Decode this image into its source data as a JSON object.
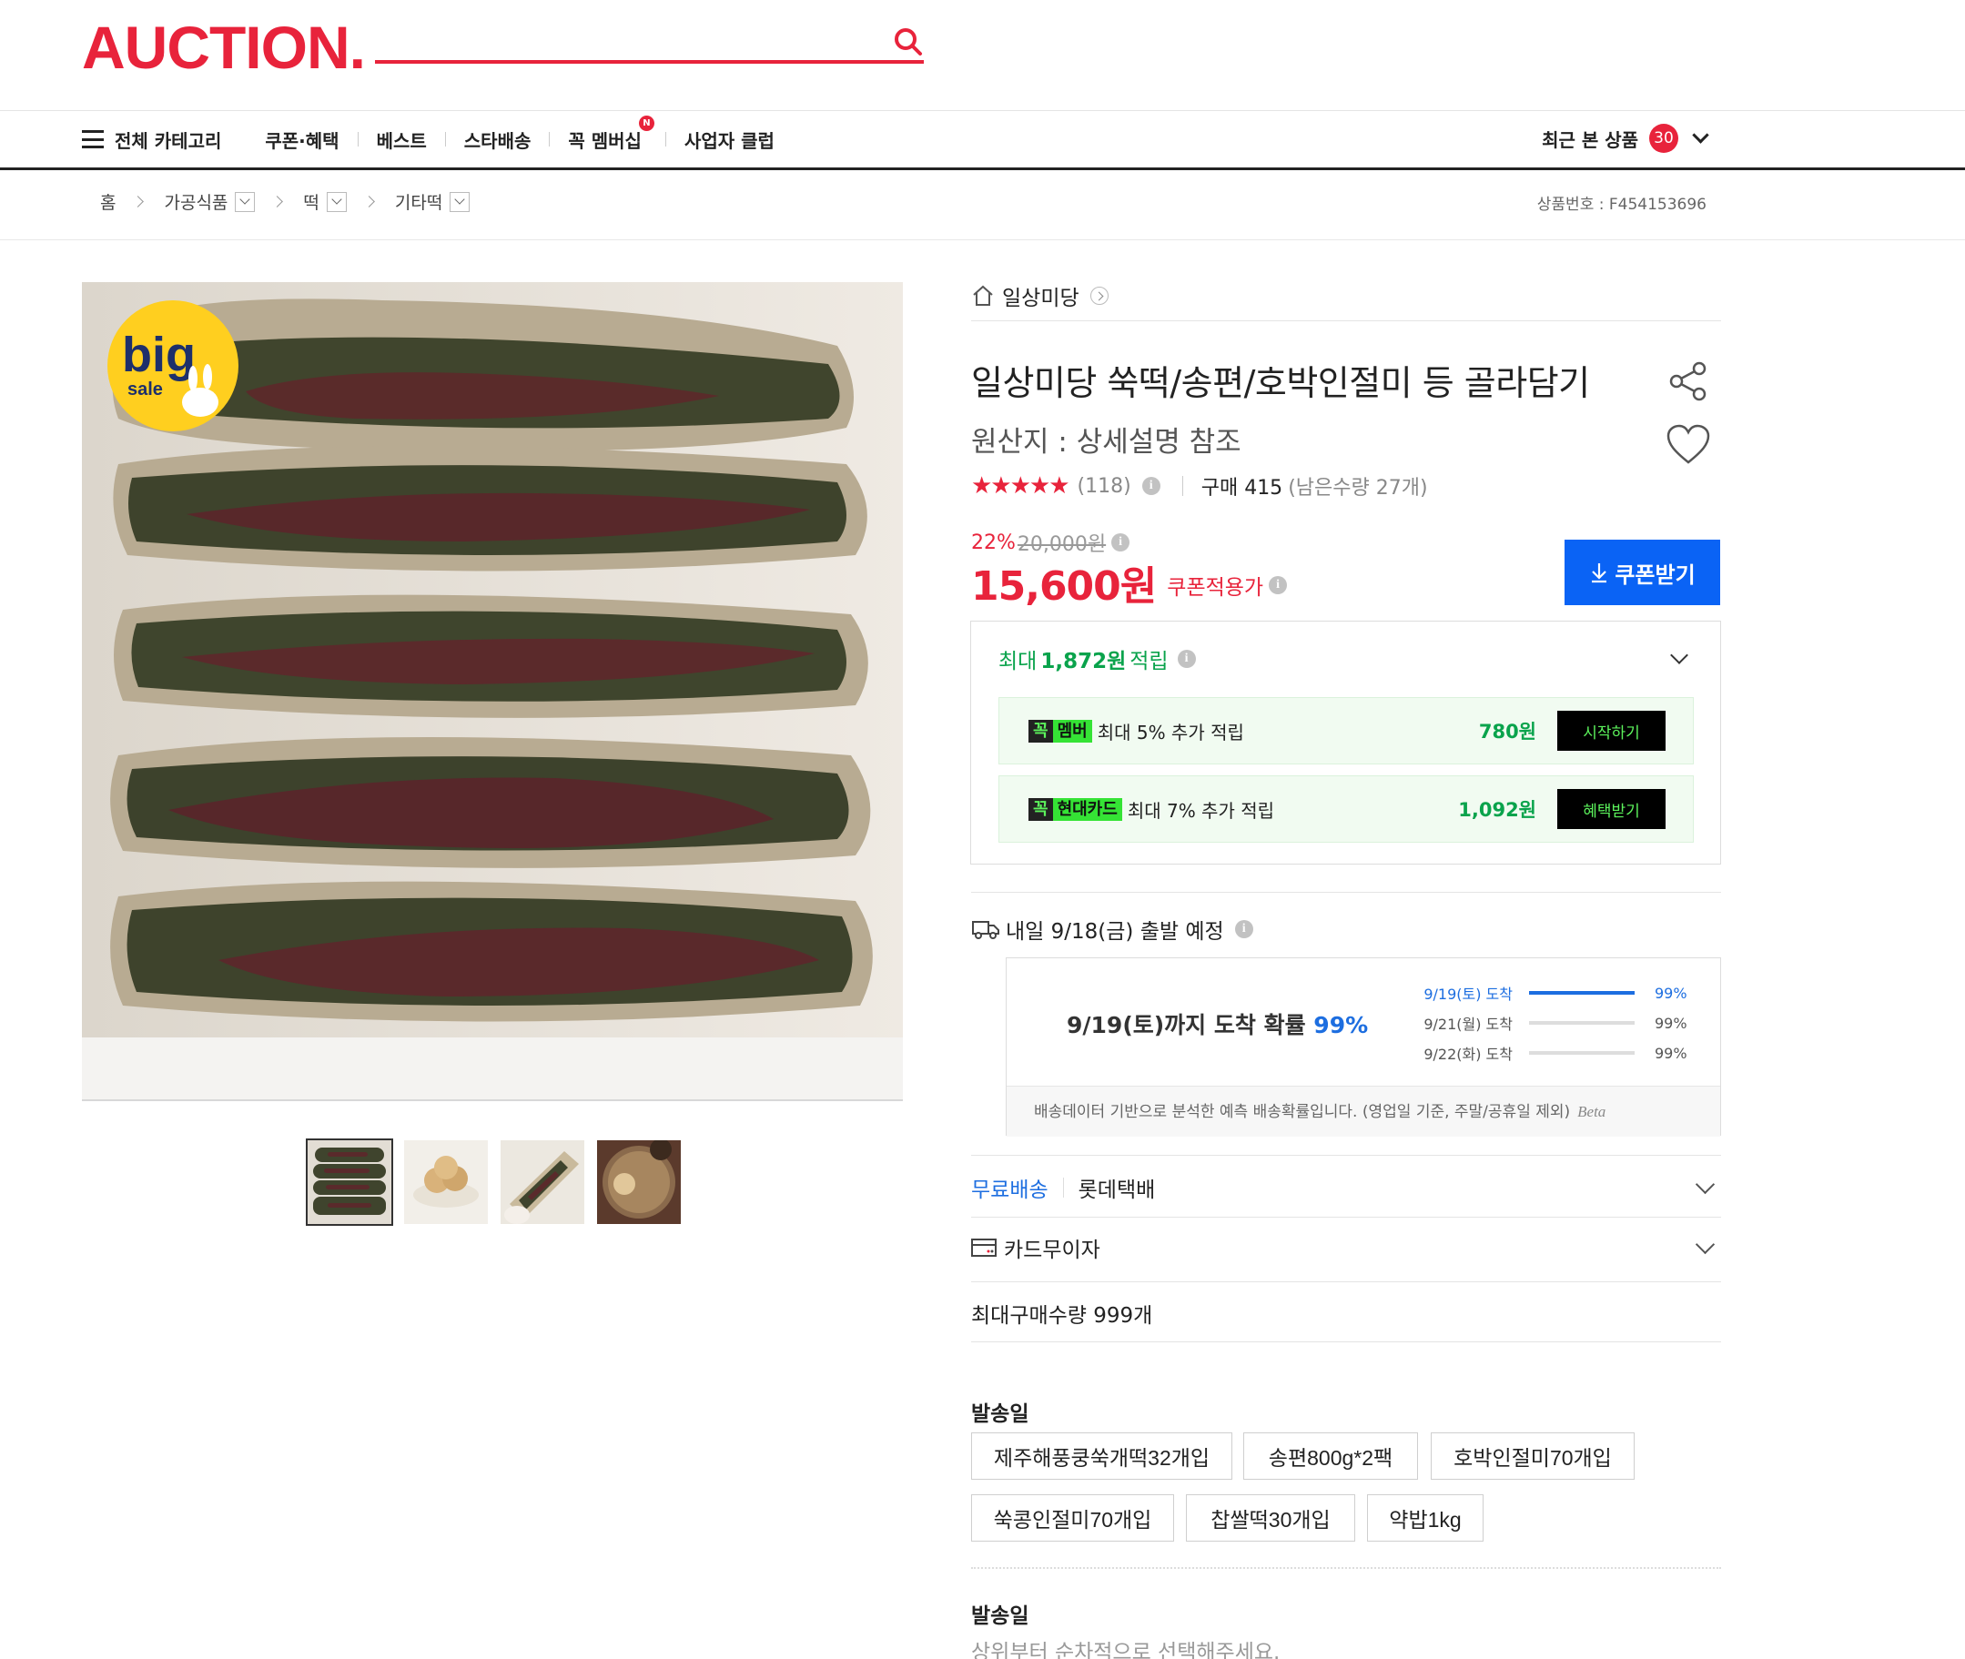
{
  "header": {
    "logo": "AUCTION.",
    "nav": {
      "all_categories": "전체 카테고리",
      "items": [
        "쿠폰·혜택",
        "베스트",
        "스타배송",
        "꼭 멤버십",
        "사업자 클럽"
      ],
      "membership_badge": "N"
    },
    "recent": {
      "label": "최근 본 상품",
      "count": "30"
    }
  },
  "breadcrumb": {
    "home": "홈",
    "levels": [
      "가공식품",
      "떡",
      "기타떡"
    ],
    "product_no": "상품번호 : F454153696"
  },
  "gallery": {
    "badge_top": "big",
    "badge_bottom": "sale",
    "thumbnail_count": 4,
    "selected_thumbnail": 1
  },
  "product": {
    "shop_name": "일상미당",
    "title": "일상미당 쑥떡/송편/호박인절미 등 골라담기",
    "origin": "원산지 : 상세설명 참조",
    "rating": 5,
    "stars": "★★★★★",
    "review_count": "(118)",
    "purchase": "구매 415",
    "remaining": "(남은수량 27개)",
    "discount_pct": "22%",
    "original_price": "20,000원",
    "price": "15,600원",
    "price_label": "쿠폰적용가",
    "coupon_button": "쿠폰받기"
  },
  "points": {
    "prefix": "최대",
    "amount": "1,872원",
    "suffix": "적립",
    "rows": [
      {
        "tag_k": "꼭",
        "tag_text": "멤버",
        "desc": "최대 5% 추가 적립",
        "amount": "780원",
        "button": "시작하기"
      },
      {
        "tag_k": "꼭",
        "tag_text": "현대카드",
        "desc": "최대 7% 추가 적립",
        "amount": "1,092원",
        "button": "혜택받기"
      }
    ]
  },
  "shipping": {
    "departure": "내일 9/18(금) 출발 예정",
    "summary_prefix": "9/19(토)까지 도착 확률",
    "summary_pct": "99%",
    "rows": [
      {
        "label": "9/19(토) 도착",
        "pct": "99%",
        "fill": 1.0
      },
      {
        "label": "9/21(월) 도착",
        "pct": "99%",
        "fill": 0.0
      },
      {
        "label": "9/22(화) 도착",
        "pct": "99%",
        "fill": 0.0
      }
    ],
    "note": "배송데이터 기반으로 분석한 예측 배송확률입니다. (영업일 기준, 주말/공휴일 제외)",
    "beta": "Beta",
    "free_label": "무료배송",
    "carrier": "롯데택배",
    "installment": "카드무이자",
    "max_qty": "최대구매수량 999개"
  },
  "options": {
    "section1_title": "발송일",
    "items": [
      "제주해풍쿵쑥개떡32개입",
      "송편800g*2팩",
      "호박인절미70개입",
      "쑥콩인절미70개입",
      "찹쌀떡30개입",
      "약밥1kg"
    ],
    "section2_title": "발송일",
    "hint": "상위부터 순차적으로 선택해주세요."
  },
  "colors": {
    "brand_red": "#e8233b",
    "coupon_blue": "#0a63f5",
    "point_green": "#0aa34c",
    "accent_blue": "#1d6ee0"
  }
}
